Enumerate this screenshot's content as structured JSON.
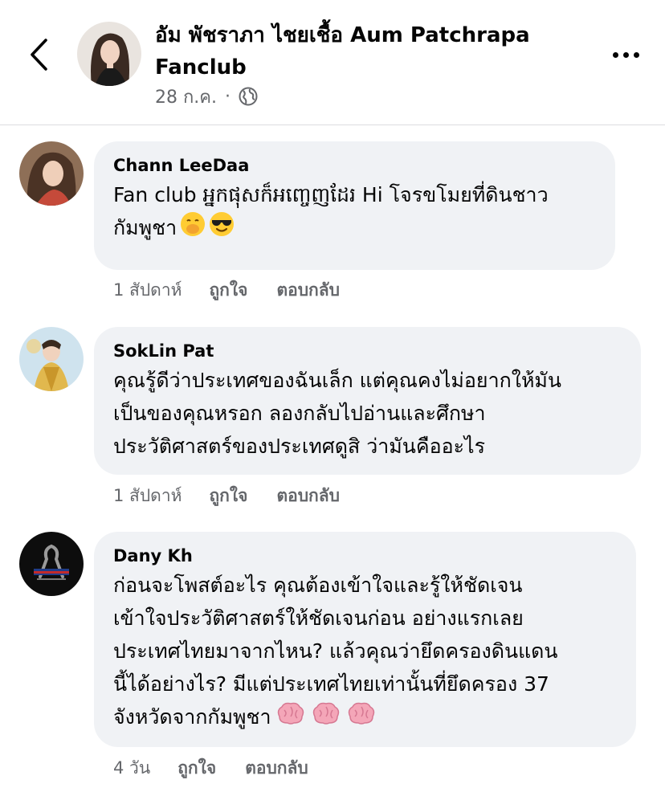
{
  "header": {
    "back_icon": "chevron-left-icon",
    "page_name": "อัม พัชราภา ไชยเชื้อ Aum Patchrapa Fanclub",
    "post_date": "28 ก.ค.",
    "separator": "·",
    "privacy_icon": "globe-icon",
    "more_icon": "more-horizontal-icon"
  },
  "comments": [
    {
      "author": "Chann LeeDaa",
      "text": "Fan club អ្នកផុសក៏អញ្ចេញដែរ Hi โจรขโมยที่ดินชาว\nกัมพูชา",
      "emojis": [
        "hand-over-mouth-emoji",
        "sunglasses-emoji"
      ],
      "time": "1 สัปดาห์",
      "like_label": "ถูกใจ",
      "reply_label": "ตอบกลับ"
    },
    {
      "author": "SokLin Pat",
      "text": "คุณรู้ดีว่าประเทศของฉันเล็ก แต่คุณคงไม่อยากให้มัน\nเป็นของคุณหรอก ลองกลับไปอ่านและศึกษา\nประวัติศาสตร์ของประเทศดูสิ ว่ามันคืออะไร",
      "time": "1 สัปดาห์",
      "like_label": "ถูกใจ",
      "reply_label": "ตอบกลับ"
    },
    {
      "author": "Dany Kh",
      "text": "ก่อนจะโพสต์อะไร คุณต้องเข้าใจและรู้ให้ชัดเจน\nเข้าใจประวัติศาสตร์ให้ชัดเจนก่อน อย่างแรกเลย\nประเทศไทยมาจากไหน? แล้วคุณว่ายึดครองดินแดน\nนี้ได้อย่างไร? มีแต่ประเทศไทยเท่านั้นที่ยึดครอง 37\nจังหวัดจากกัมพูชา",
      "emojis": [
        "brain-emoji",
        "brain-emoji",
        "brain-emoji"
      ],
      "time": "4 วัน",
      "like_label": "ถูกใจ",
      "reply_label": "ตอบกลับ"
    }
  ],
  "colors": {
    "bubble": "#f0f2f5",
    "secondary_text": "#65676b",
    "primary_text": "#050505"
  }
}
